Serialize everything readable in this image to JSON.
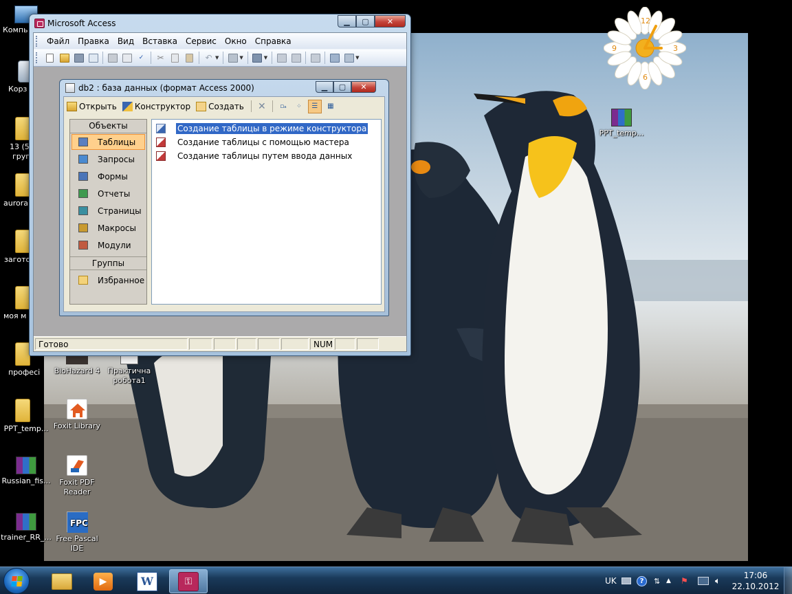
{
  "desktop": {
    "icons": [
      {
        "label": "Компь"
      },
      {
        "label": "Корз"
      },
      {
        "label": "13 (5"
      },
      {
        "label": "груп"
      },
      {
        "label": "aurora"
      },
      {
        "label": "загото"
      },
      {
        "label": "моя м"
      },
      {
        "label": "професі"
      },
      {
        "label": "PPT_temp..."
      },
      {
        "label": "Russian_fis..."
      },
      {
        "label": "trainer_RR_..."
      },
      {
        "label": "BioHazard 4"
      },
      {
        "label": "Практична робота1"
      },
      {
        "label": "Foxit Library"
      },
      {
        "label": "Foxit PDF Reader"
      },
      {
        "label": "Free Pascal IDE"
      },
      {
        "label": "PPT_temp..."
      }
    ]
  },
  "clock_gadget": {
    "numbers": [
      "12",
      "3",
      "6",
      "9"
    ]
  },
  "access": {
    "title": "Microsoft Access",
    "menu": [
      "Файл",
      "Правка",
      "Вид",
      "Вставка",
      "Сервис",
      "Окно",
      "Справка"
    ],
    "status": {
      "text": "Готово",
      "num": "NUM"
    }
  },
  "db_window": {
    "title": "db2 : база данных (формат Access 2000)",
    "toolbar": {
      "open": "Открыть",
      "design": "Конструктор",
      "create": "Создать"
    },
    "objects_header": "Объекты",
    "objects": [
      {
        "label": "Таблицы",
        "icon": "table-icon",
        "color": "#5a7fc0"
      },
      {
        "label": "Запросы",
        "icon": "query-icon",
        "color": "#4a8ad0"
      },
      {
        "label": "Формы",
        "icon": "form-icon",
        "color": "#4a74b8"
      },
      {
        "label": "Отчеты",
        "icon": "report-icon",
        "color": "#3f9a4f"
      },
      {
        "label": "Страницы",
        "icon": "page-icon",
        "color": "#3a8fa0"
      },
      {
        "label": "Макросы",
        "icon": "macro-icon",
        "color": "#c89a30"
      },
      {
        "label": "Модули",
        "icon": "module-icon",
        "color": "#c05a40"
      }
    ],
    "groups_header": "Группы",
    "groups": [
      {
        "label": "Избранное",
        "icon": "favorites-folder-icon"
      }
    ],
    "items": [
      {
        "label": "Создание таблицы в режиме конструктора",
        "selected": true
      },
      {
        "label": "Создание таблицы с помощью мастера",
        "selected": false
      },
      {
        "label": "Создание таблицы путем ввода данных",
        "selected": false
      }
    ]
  },
  "taskbar": {
    "language": "UK",
    "time": "17:06",
    "date": "22.10.2012"
  }
}
